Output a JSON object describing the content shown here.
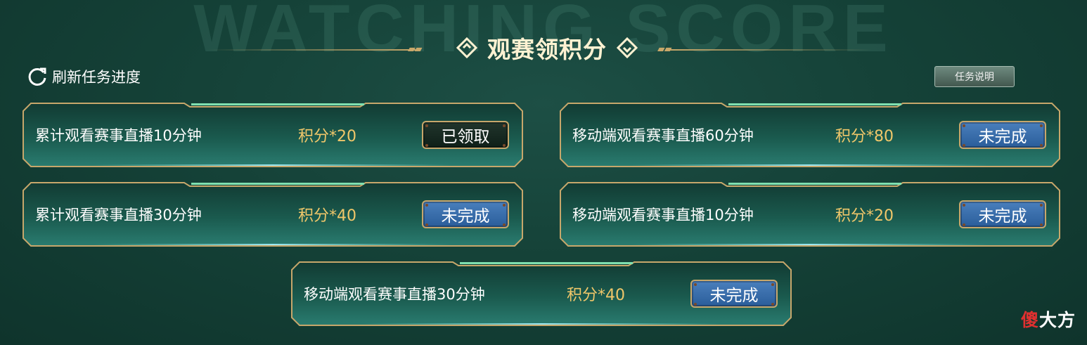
{
  "background_text": "WATCHING SCORE",
  "header": {
    "title": "观赛领积分"
  },
  "refresh": {
    "label": "刷新任务进度"
  },
  "task_info_button": {
    "label": "任务说明"
  },
  "colors": {
    "points_gold": "#f0c76a",
    "status_blue": "#2a5d9a",
    "status_dark": "#0f1f18",
    "frame_gold": "#c7a76b"
  },
  "tasks": [
    {
      "description": "累计观看赛事直播10分钟",
      "points": "积分*20",
      "status": "已领取"
    },
    {
      "description": "移动端观看赛事直播60分钟",
      "points": "积分*80",
      "status": "未完成"
    },
    {
      "description": "累计观看赛事直播30分钟",
      "points": "积分*40",
      "status": "未完成"
    },
    {
      "description": "移动端观看赛事直播10分钟",
      "points": "积分*20",
      "status": "未完成"
    },
    {
      "description": "移动端观看赛事直播30分钟",
      "points": "积分*40",
      "status": "未完成"
    }
  ],
  "watermark": {
    "first": "傻",
    "rest": "大方"
  }
}
